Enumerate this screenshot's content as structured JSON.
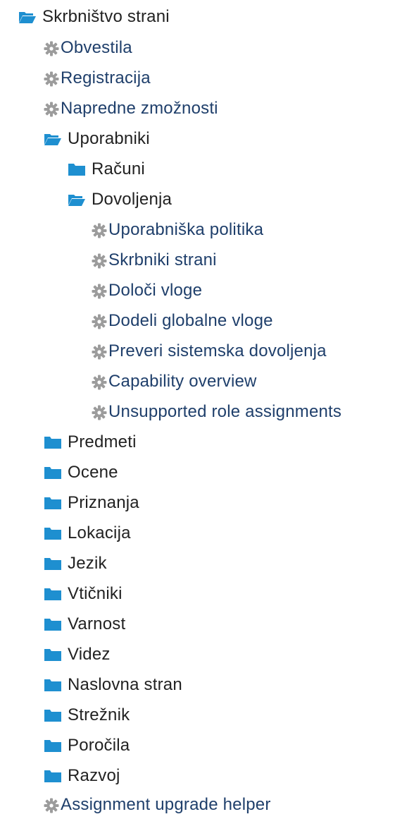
{
  "colors": {
    "folder": "#1e8fd0",
    "folder_open": "#1e8fd0",
    "gear": "#9c9c9c",
    "link_text": "#1f3f6b",
    "category_text": "#222222"
  },
  "tree": {
    "root": {
      "label": "Skrbništvo strani",
      "icon": "folder-open-icon"
    },
    "site_links": [
      {
        "label": "Obvestila",
        "icon": "gear-icon"
      },
      {
        "label": "Registracija",
        "icon": "gear-icon"
      },
      {
        "label": "Napredne zmožnosti",
        "icon": "gear-icon"
      }
    ],
    "users": {
      "label": "Uporabniki",
      "icon": "folder-open-icon",
      "accounts": {
        "label": "Računi",
        "icon": "folder-icon"
      },
      "permissions": {
        "label": "Dovoljenja",
        "icon": "folder-open-icon",
        "items": [
          {
            "label": "Uporabniška politika",
            "icon": "gear-icon"
          },
          {
            "label": "Skrbniki strani",
            "icon": "gear-icon"
          },
          {
            "label": "Določi vloge",
            "icon": "gear-icon"
          },
          {
            "label": "Dodeli globalne vloge",
            "icon": "gear-icon"
          },
          {
            "label": "Preveri sistemska dovoljenja",
            "icon": "gear-icon"
          },
          {
            "label": "Capability overview",
            "icon": "gear-icon"
          },
          {
            "label": "Unsupported role assignments",
            "icon": "gear-icon"
          }
        ]
      }
    },
    "categories": [
      {
        "label": "Predmeti",
        "icon": "folder-icon"
      },
      {
        "label": "Ocene",
        "icon": "folder-icon"
      },
      {
        "label": "Priznanja",
        "icon": "folder-icon"
      },
      {
        "label": "Lokacija",
        "icon": "folder-icon"
      },
      {
        "label": "Jezik",
        "icon": "folder-icon"
      },
      {
        "label": "Vtičniki",
        "icon": "folder-icon"
      },
      {
        "label": "Varnost",
        "icon": "folder-icon"
      },
      {
        "label": "Videz",
        "icon": "folder-icon"
      },
      {
        "label": "Naslovna stran",
        "icon": "folder-icon"
      },
      {
        "label": "Strežnik",
        "icon": "folder-icon"
      },
      {
        "label": "Poročila",
        "icon": "folder-icon"
      },
      {
        "label": "Razvoj",
        "icon": "folder-icon"
      }
    ],
    "bottom_link": {
      "label": "Assignment upgrade helper",
      "icon": "gear-icon"
    }
  }
}
